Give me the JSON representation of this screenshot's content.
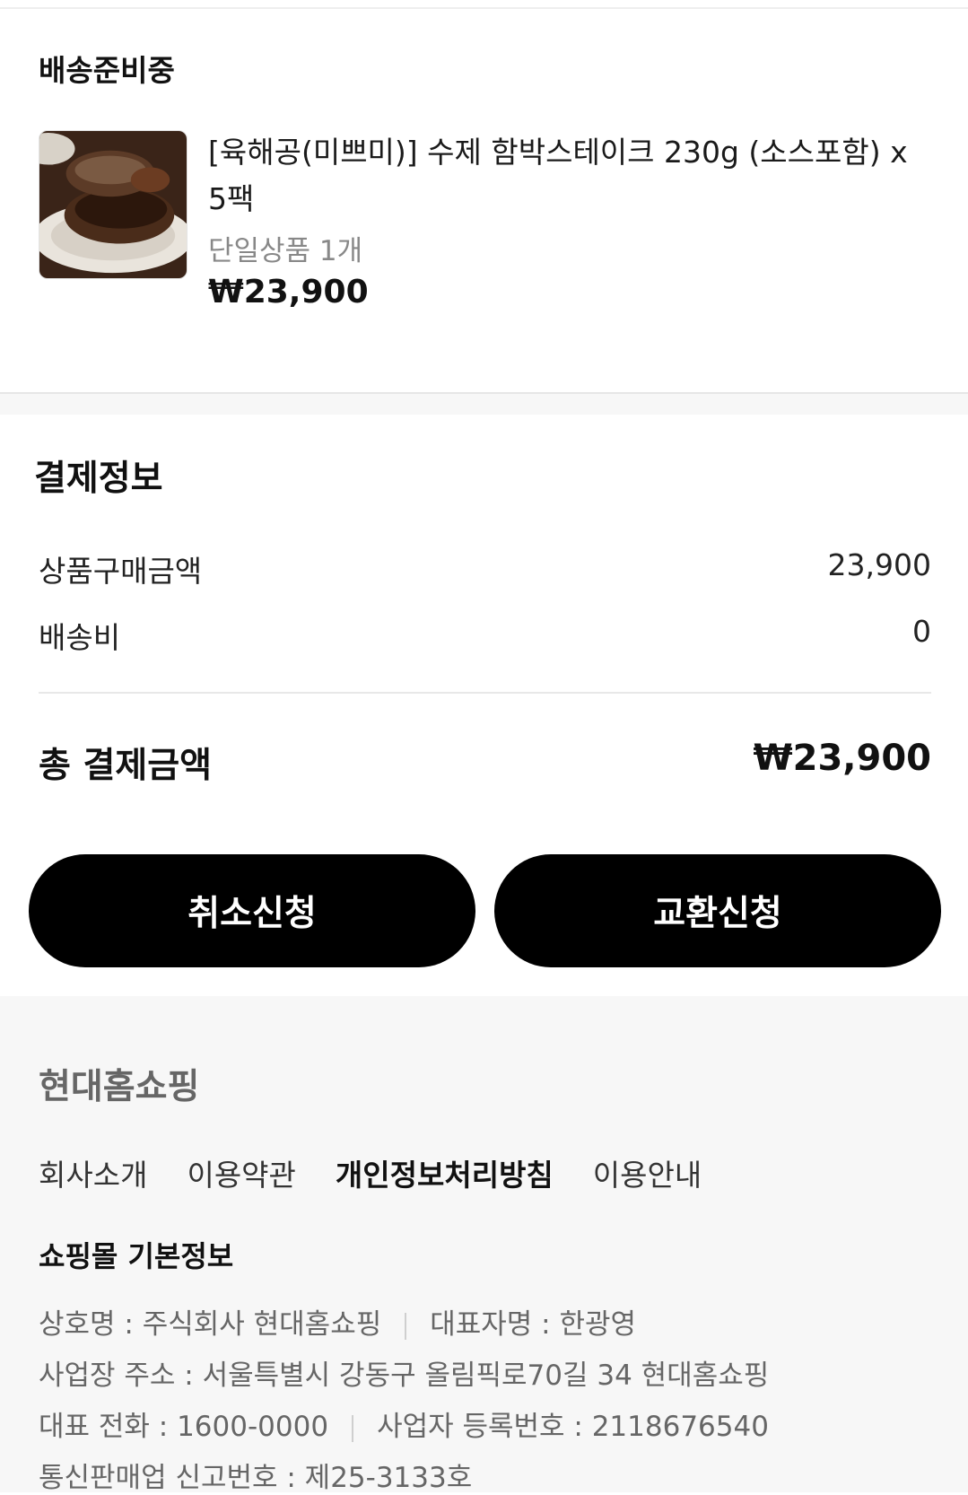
{
  "order": {
    "status": "배송준비중",
    "product": {
      "name": "[육해공(미쁘미)] 수제 함박스테이크 230g (소스포함) x 5팩",
      "option": "단일상품 1개",
      "price": "₩23,900",
      "image_icon": "hamburg-steak-photo"
    }
  },
  "payment": {
    "title": "결제정보",
    "rows": [
      {
        "label": "상품구매금액",
        "value": "23,900"
      },
      {
        "label": "배송비",
        "value": "0"
      }
    ],
    "total_label": "총 결제금액",
    "total_value": "₩23,900"
  },
  "actions": {
    "cancel_label": "취소신청",
    "exchange_label": "교환신청"
  },
  "footer": {
    "brand": "현대홈쇼핑",
    "links": [
      "회사소개",
      "이용약관",
      "개인정보처리방침",
      "이용안내"
    ],
    "info_title": "쇼핑몰 기본정보",
    "company_name": "상호명 : 주식회사 현대홈쇼핑",
    "ceo": "대표자명 : 한광영",
    "address": "사업장 주소 : 서울특별시 강동구 올림픽로70길 34 현대홈쇼핑",
    "phone": "대표 전화 : 1600-0000",
    "biz_no": "사업자 등록번호 : 2118676540",
    "ecommerce_no": "통신판매업 신고번호 : 제25-3133호"
  }
}
